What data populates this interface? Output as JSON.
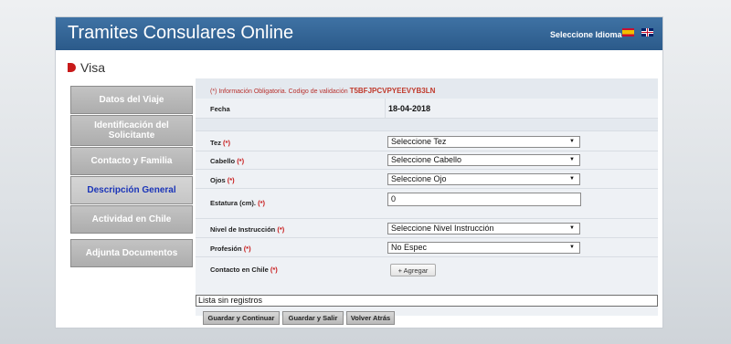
{
  "header": {
    "title": "Tramites Consulares Online",
    "language_label": "Seleccione Idioma"
  },
  "section": {
    "title": "Visa"
  },
  "menu": [
    {
      "label": "Datos del Viaje"
    },
    {
      "label": "Identificación del Solicitante"
    },
    {
      "label": "Contacto y Familia"
    },
    {
      "label": "Descripción General"
    },
    {
      "label": "Actividad en Chile"
    },
    {
      "label": "Adjunta Documentos"
    }
  ],
  "form": {
    "required_note": "(*) Información Obligatoria.",
    "validation_text": "Codigo de validación",
    "validation_code": "T5BFJPCVPYEEVYB3LN",
    "fecha_label": "Fecha",
    "fecha_value": "18-04-2018",
    "tez_label": "Tez",
    "tez_value": "Seleccione Tez",
    "cabello_label": "Cabello",
    "cabello_value": "Seleccione Cabello",
    "ojos_label": "Ojos",
    "ojos_value": "Seleccione Ojo",
    "estatura_label": "Estatura (cm).",
    "estatura_value": "0",
    "nivel_label": "Nivel de Instrucción",
    "nivel_value": "Seleccione Nivel Instrucción",
    "profesion_label": "Profesión",
    "profesion_value": "No Espec",
    "contacto_label": "Contacto en Chile",
    "add_button": "+ Agregar",
    "list_empty": "Lista sin registros",
    "required_star": "(*)"
  },
  "actions": {
    "save_continue": "Guardar y Continuar",
    "save_exit": "Guardar y Salir",
    "back": "Volver Atrás"
  },
  "colors": {
    "header_blue": "#2b5a8a",
    "required_red": "#c81a1a",
    "active_menu_text": "#1a34b8"
  }
}
